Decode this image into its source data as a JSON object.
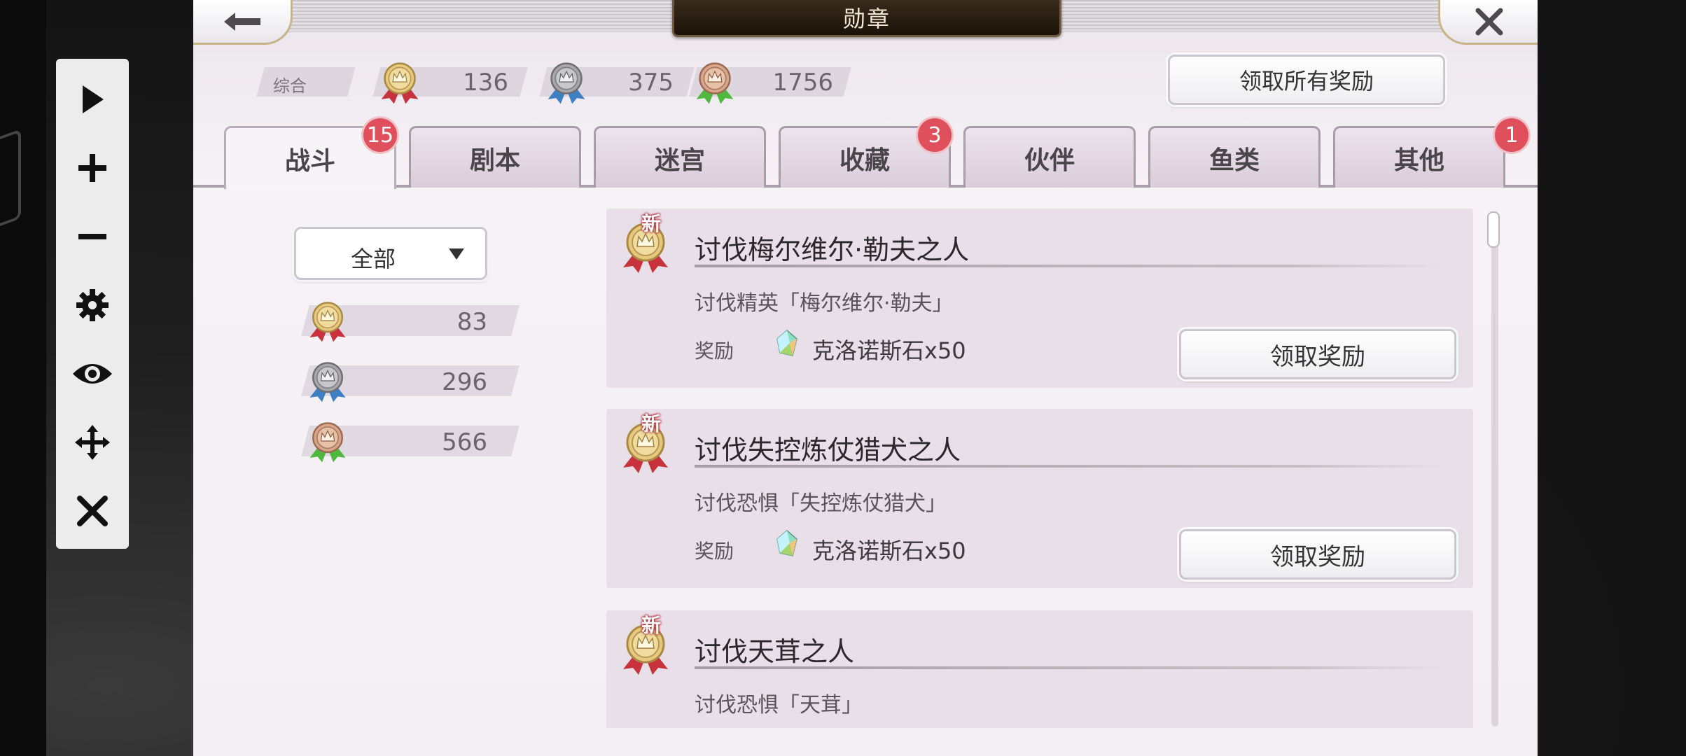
{
  "header": {
    "title": "勋章"
  },
  "summary": {
    "label": "综合",
    "gold": "136",
    "silver": "375",
    "bronze": "1756"
  },
  "claim_all_label": "领取所有奖励",
  "tabs": [
    {
      "label": "战斗",
      "badge": "15",
      "active": true
    },
    {
      "label": "剧本"
    },
    {
      "label": "迷宫"
    },
    {
      "label": "收藏",
      "badge": "3"
    },
    {
      "label": "伙伴"
    },
    {
      "label": "鱼类"
    },
    {
      "label": "其他",
      "badge": "1"
    }
  ],
  "filter": {
    "selected": "全部"
  },
  "counts": {
    "gold": "83",
    "silver": "296",
    "bronze": "566"
  },
  "medals": [
    {
      "new_tag": "新",
      "title": "讨伐梅尔维尔·勒夫之人",
      "desc": "讨伐精英「梅尔维尔·勒夫」",
      "reward_label": "奖励",
      "reward": "克洛诺斯石x50",
      "button": "领取奖励"
    },
    {
      "new_tag": "新",
      "title": "讨伐失控炼仗猎犬之人",
      "desc": "讨伐恐惧「失控炼仗猎犬」",
      "reward_label": "奖励",
      "reward": "克洛诺斯石x50",
      "button": "领取奖励"
    },
    {
      "new_tag": "新",
      "title": "讨伐天茸之人",
      "desc": "讨伐恐惧「天茸」"
    }
  ],
  "colors": {
    "gold": "#d9b768",
    "silver": "#8f8f95",
    "bronze": "#c98f74",
    "ribbon_red": "#c8323c",
    "ribbon_blue": "#3f7fc4",
    "ribbon_green": "#4fb83f",
    "badge": "#e0505c"
  },
  "toolbar_icons": [
    "play-icon",
    "plus-icon",
    "minus-icon",
    "gear-icon",
    "eye-icon",
    "move-icon",
    "close-icon"
  ]
}
